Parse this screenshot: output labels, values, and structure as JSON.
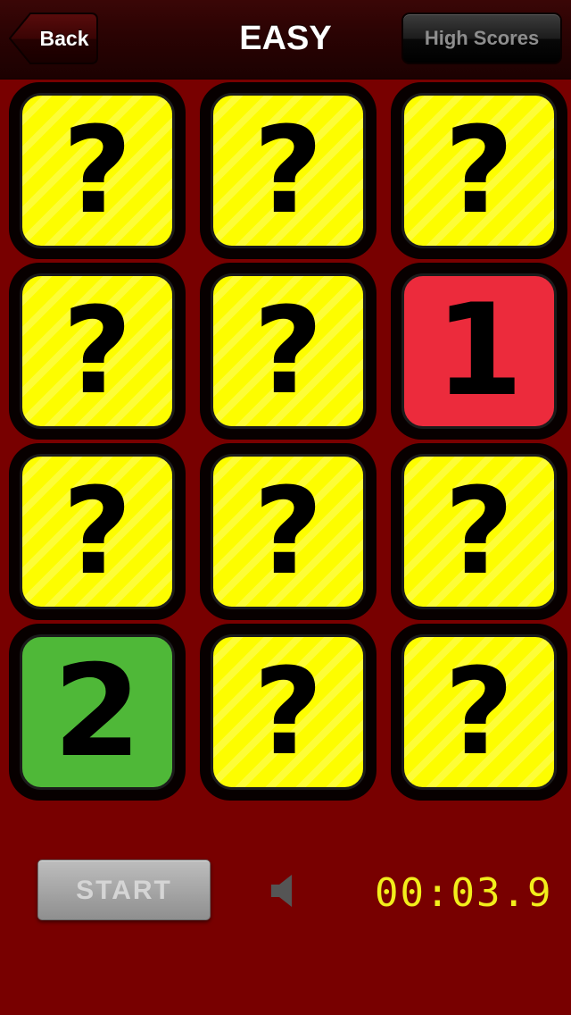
{
  "navbar": {
    "title": "EASY",
    "back_label": "Back",
    "high_scores_label": "High Scores"
  },
  "tiles": [
    {
      "state": "hidden",
      "symbol": "?"
    },
    {
      "state": "hidden",
      "symbol": "?"
    },
    {
      "state": "hidden",
      "symbol": "?"
    },
    {
      "state": "hidden",
      "symbol": "?"
    },
    {
      "state": "hidden",
      "symbol": "?"
    },
    {
      "state": "revealed",
      "symbol": "1",
      "color": "#ec2b3c"
    },
    {
      "state": "hidden",
      "symbol": "?"
    },
    {
      "state": "hidden",
      "symbol": "?"
    },
    {
      "state": "hidden",
      "symbol": "?"
    },
    {
      "state": "revealed",
      "symbol": "2",
      "color": "#4fb838"
    },
    {
      "state": "hidden",
      "symbol": "?"
    },
    {
      "state": "hidden",
      "symbol": "?"
    }
  ],
  "controls": {
    "start_label": "START",
    "speaker_icon": "speaker-icon",
    "timer": "00:03.9"
  },
  "colors": {
    "background": "#780000",
    "tile_hidden": "#fdfd00",
    "timer": "#f2ee1b"
  }
}
